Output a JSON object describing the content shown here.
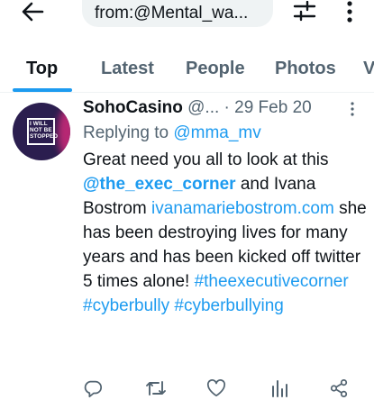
{
  "search": {
    "query": "from:@Mental_wa..."
  },
  "tabs": [
    {
      "label": "Top",
      "active": true
    },
    {
      "label": "Latest"
    },
    {
      "label": "People"
    },
    {
      "label": "Photos"
    },
    {
      "label": "V"
    }
  ],
  "tweet": {
    "avatar_text": "I WILL NOT BE STOPPED",
    "name": "SohoCasino",
    "handle": "@...",
    "separator": "·",
    "date": "29 Feb 20",
    "replying_prefix": "Replying to",
    "replying_to": "@mma_mv",
    "text": {
      "part1": "Great need you all to look at this",
      "mention": "@the_exec_corner",
      "part2": "and Ivana Bostrom",
      "url": "ivanamariebostrom.com",
      "part3": "she has been destroying lives for many years and has been kicked off twitter 5 times alone!",
      "hashtag1": "#theexecutivecorner",
      "hashtag2": "#cyberbully",
      "hashtag3": "#cyberbullying"
    }
  },
  "icons": {
    "back": "arrow-left-icon",
    "filter": "sliders-icon",
    "more": "more-vertical-icon",
    "reply": "reply-icon",
    "retweet": "retweet-icon",
    "like": "heart-icon",
    "views": "bar-chart-icon",
    "share": "share-icon"
  },
  "colors": {
    "accent": "#1d9bf0",
    "text": "#0f1419",
    "muted": "#536471"
  }
}
